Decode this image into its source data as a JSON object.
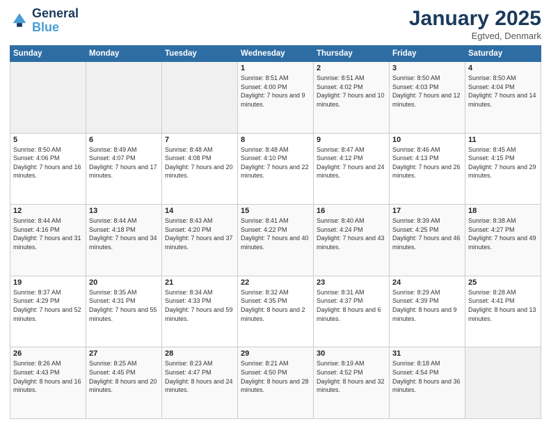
{
  "header": {
    "logo_line1": "General",
    "logo_line2": "Blue",
    "title": "January 2025",
    "subtitle": "Egtved, Denmark"
  },
  "weekdays": [
    "Sunday",
    "Monday",
    "Tuesday",
    "Wednesday",
    "Thursday",
    "Friday",
    "Saturday"
  ],
  "weeks": [
    [
      {
        "day": "",
        "info": ""
      },
      {
        "day": "",
        "info": ""
      },
      {
        "day": "",
        "info": ""
      },
      {
        "day": "1",
        "info": "Sunrise: 8:51 AM\nSunset: 4:00 PM\nDaylight: 7 hours and 9 minutes."
      },
      {
        "day": "2",
        "info": "Sunrise: 8:51 AM\nSunset: 4:02 PM\nDaylight: 7 hours and 10 minutes."
      },
      {
        "day": "3",
        "info": "Sunrise: 8:50 AM\nSunset: 4:03 PM\nDaylight: 7 hours and 12 minutes."
      },
      {
        "day": "4",
        "info": "Sunrise: 8:50 AM\nSunset: 4:04 PM\nDaylight: 7 hours and 14 minutes."
      }
    ],
    [
      {
        "day": "5",
        "info": "Sunrise: 8:50 AM\nSunset: 4:06 PM\nDaylight: 7 hours and 16 minutes."
      },
      {
        "day": "6",
        "info": "Sunrise: 8:49 AM\nSunset: 4:07 PM\nDaylight: 7 hours and 17 minutes."
      },
      {
        "day": "7",
        "info": "Sunrise: 8:48 AM\nSunset: 4:08 PM\nDaylight: 7 hours and 20 minutes."
      },
      {
        "day": "8",
        "info": "Sunrise: 8:48 AM\nSunset: 4:10 PM\nDaylight: 7 hours and 22 minutes."
      },
      {
        "day": "9",
        "info": "Sunrise: 8:47 AM\nSunset: 4:12 PM\nDaylight: 7 hours and 24 minutes."
      },
      {
        "day": "10",
        "info": "Sunrise: 8:46 AM\nSunset: 4:13 PM\nDaylight: 7 hours and 26 minutes."
      },
      {
        "day": "11",
        "info": "Sunrise: 8:45 AM\nSunset: 4:15 PM\nDaylight: 7 hours and 29 minutes."
      }
    ],
    [
      {
        "day": "12",
        "info": "Sunrise: 8:44 AM\nSunset: 4:16 PM\nDaylight: 7 hours and 31 minutes."
      },
      {
        "day": "13",
        "info": "Sunrise: 8:44 AM\nSunset: 4:18 PM\nDaylight: 7 hours and 34 minutes."
      },
      {
        "day": "14",
        "info": "Sunrise: 8:43 AM\nSunset: 4:20 PM\nDaylight: 7 hours and 37 minutes."
      },
      {
        "day": "15",
        "info": "Sunrise: 8:41 AM\nSunset: 4:22 PM\nDaylight: 7 hours and 40 minutes."
      },
      {
        "day": "16",
        "info": "Sunrise: 8:40 AM\nSunset: 4:24 PM\nDaylight: 7 hours and 43 minutes."
      },
      {
        "day": "17",
        "info": "Sunrise: 8:39 AM\nSunset: 4:25 PM\nDaylight: 7 hours and 46 minutes."
      },
      {
        "day": "18",
        "info": "Sunrise: 8:38 AM\nSunset: 4:27 PM\nDaylight: 7 hours and 49 minutes."
      }
    ],
    [
      {
        "day": "19",
        "info": "Sunrise: 8:37 AM\nSunset: 4:29 PM\nDaylight: 7 hours and 52 minutes."
      },
      {
        "day": "20",
        "info": "Sunrise: 8:35 AM\nSunset: 4:31 PM\nDaylight: 7 hours and 55 minutes."
      },
      {
        "day": "21",
        "info": "Sunrise: 8:34 AM\nSunset: 4:33 PM\nDaylight: 7 hours and 59 minutes."
      },
      {
        "day": "22",
        "info": "Sunrise: 8:32 AM\nSunset: 4:35 PM\nDaylight: 8 hours and 2 minutes."
      },
      {
        "day": "23",
        "info": "Sunrise: 8:31 AM\nSunset: 4:37 PM\nDaylight: 8 hours and 6 minutes."
      },
      {
        "day": "24",
        "info": "Sunrise: 8:29 AM\nSunset: 4:39 PM\nDaylight: 8 hours and 9 minutes."
      },
      {
        "day": "25",
        "info": "Sunrise: 8:28 AM\nSunset: 4:41 PM\nDaylight: 8 hours and 13 minutes."
      }
    ],
    [
      {
        "day": "26",
        "info": "Sunrise: 8:26 AM\nSunset: 4:43 PM\nDaylight: 8 hours and 16 minutes."
      },
      {
        "day": "27",
        "info": "Sunrise: 8:25 AM\nSunset: 4:45 PM\nDaylight: 8 hours and 20 minutes."
      },
      {
        "day": "28",
        "info": "Sunrise: 8:23 AM\nSunset: 4:47 PM\nDaylight: 8 hours and 24 minutes."
      },
      {
        "day": "29",
        "info": "Sunrise: 8:21 AM\nSunset: 4:50 PM\nDaylight: 8 hours and 28 minutes."
      },
      {
        "day": "30",
        "info": "Sunrise: 8:19 AM\nSunset: 4:52 PM\nDaylight: 8 hours and 32 minutes."
      },
      {
        "day": "31",
        "info": "Sunrise: 8:18 AM\nSunset: 4:54 PM\nDaylight: 8 hours and 36 minutes."
      },
      {
        "day": "",
        "info": ""
      }
    ]
  ]
}
